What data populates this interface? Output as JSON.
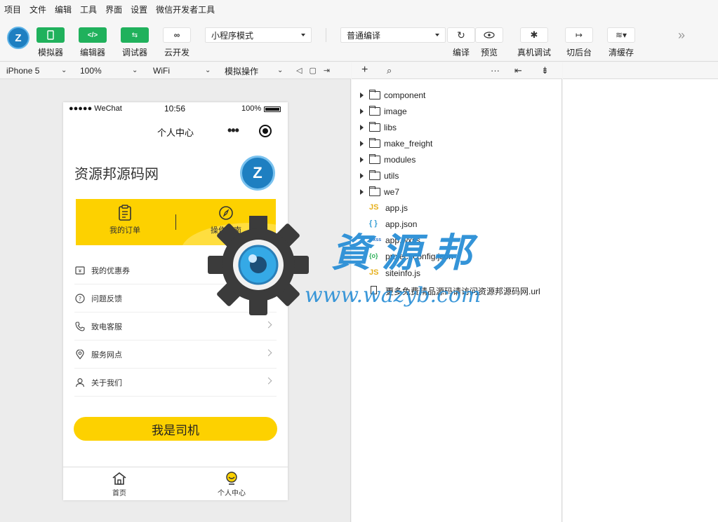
{
  "menubar": [
    "项目",
    "文件",
    "编辑",
    "工具",
    "界面",
    "设置",
    "微信开发者工具"
  ],
  "toolbar": {
    "logo_text": "Z",
    "buttons": [
      {
        "label": "模拟器",
        "icon": "phone-icon"
      },
      {
        "label": "编辑器",
        "icon": "code-icon"
      },
      {
        "label": "调试器",
        "icon": "debug-icon"
      },
      {
        "label": "云开发",
        "icon": "cloud-icon"
      }
    ],
    "mode_select": "小程序模式",
    "compile_select": "普通编译",
    "right_buttons": [
      {
        "label": "编译",
        "icon": "refresh-icon"
      },
      {
        "label": "预览",
        "icon": "eye-icon"
      },
      {
        "label": "真机调试",
        "icon": "bug-icon"
      },
      {
        "label": "切后台",
        "icon": "switch-icon"
      },
      {
        "label": "清缓存",
        "icon": "layers-icon"
      }
    ],
    "more": "»"
  },
  "devbar": {
    "device": "iPhone 5",
    "zoom": "100%",
    "network": "WiFi",
    "operation": "模拟操作"
  },
  "phone": {
    "carrier": "●●●●● WeChat",
    "time": "10:56",
    "battery": "100%",
    "nav_title": "个人中心",
    "capsule_dots": "•••",
    "shop_name": "资源邦源码网",
    "avatar_text": "Z",
    "quick": [
      {
        "label": "我的订单",
        "icon": "clipboard-icon"
      },
      {
        "label": "操作指南",
        "icon": "compass-icon"
      }
    ],
    "menu": [
      {
        "label": "我的优惠券",
        "icon": "coupon-icon"
      },
      {
        "label": "问题反馈",
        "icon": "question-icon"
      },
      {
        "label": "致电客服",
        "icon": "phone-call-icon"
      },
      {
        "label": "服务网点",
        "icon": "location-icon"
      },
      {
        "label": "关于我们",
        "icon": "user-icon"
      }
    ],
    "driver_button": "我是司机",
    "tabs": [
      {
        "label": "首页",
        "icon": "home-icon"
      },
      {
        "label": "个人中心",
        "icon": "profile-icon"
      }
    ]
  },
  "explorer": {
    "folders": [
      "component",
      "image",
      "libs",
      "make_freight",
      "modules",
      "utils",
      "we7"
    ],
    "files": [
      {
        "name": "app.js",
        "type": "JS"
      },
      {
        "name": "app.json",
        "type": "{ }"
      },
      {
        "name": "app.wxss",
        "type": "wxss"
      },
      {
        "name": "project.config.json",
        "type": "{o}"
      },
      {
        "name": "siteinfo.js",
        "type": "JS"
      },
      {
        "name": "更多免费精品源码请访问资源邦源码网.url",
        "type": "doc"
      }
    ]
  },
  "watermark": {
    "text": "資源邦",
    "url": "www.wazyb.com"
  },
  "colors": {
    "green": "#20b15c",
    "yellow": "#fdd100",
    "watermark_blue": "#2a8fd6"
  }
}
